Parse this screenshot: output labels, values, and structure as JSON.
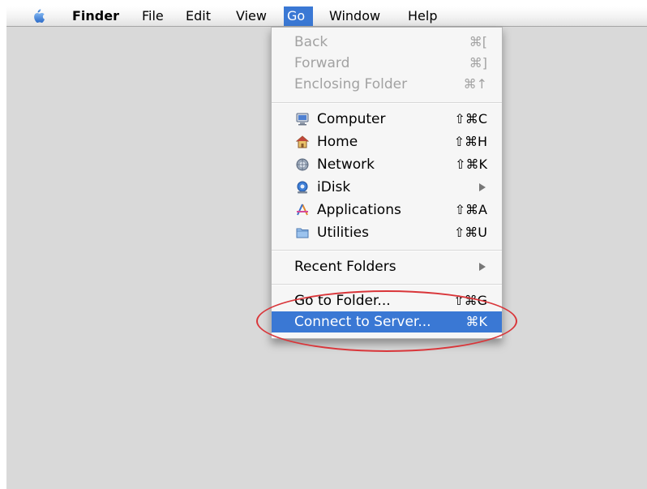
{
  "menubar": {
    "apple": "apple-icon",
    "items": [
      "Finder",
      "File",
      "Edit",
      "View",
      "Go",
      "Window",
      "Help"
    ]
  },
  "menu": {
    "group1": [
      {
        "label": "Back",
        "shortcut": "⌘[",
        "enabled": false
      },
      {
        "label": "Forward",
        "shortcut": "⌘]",
        "enabled": false
      },
      {
        "label": "Enclosing Folder",
        "shortcut": "⌘↑",
        "enabled": false
      }
    ],
    "group2": [
      {
        "label": "Computer",
        "shortcut": "⇧⌘C",
        "icon": "computer-icon"
      },
      {
        "label": "Home",
        "shortcut": "⇧⌘H",
        "icon": "home-icon"
      },
      {
        "label": "Network",
        "shortcut": "⇧⌘K",
        "icon": "network-icon"
      },
      {
        "label": "iDisk",
        "shortcut": "",
        "icon": "idisk-icon",
        "submenu": true
      },
      {
        "label": "Applications",
        "shortcut": "⇧⌘A",
        "icon": "applications-icon"
      },
      {
        "label": "Utilities",
        "shortcut": "⇧⌘U",
        "icon": "utilities-folder-icon"
      }
    ],
    "group3": [
      {
        "label": "Recent Folders",
        "submenu": true
      }
    ],
    "group4": [
      {
        "label": "Go to Folder...",
        "shortcut": "⇧⌘G"
      },
      {
        "label": "Connect to Server...",
        "shortcut": "⌘K",
        "selected": true
      }
    ]
  },
  "colors": {
    "selection": "#3a78d4",
    "annotation": "#d9363a",
    "desktop": "#d9d9d9"
  }
}
